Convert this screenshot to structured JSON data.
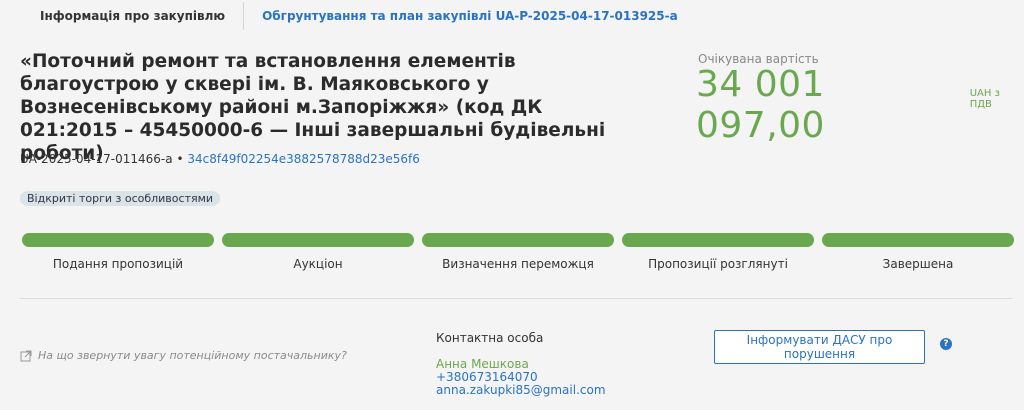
{
  "tabs": [
    {
      "label": "Інформація про закупівлю"
    },
    {
      "label": "Обгрунтування та план закупівлі UA-P-2025-04-17-013925-a"
    }
  ],
  "tender": {
    "title": "«Поточний ремонт та встановлення елементів благоустрою у сквері ім. В. Маяковського у Вознесенівському районі м.Запоріжжя» (код ДК 021:2015 – 45450000-6 — Інші завершальні будівельні роботи)",
    "id": "UA-2025-04-17-011466-a",
    "separator": "•",
    "hash": "34c8f49f02254e3882578788d23e56f6",
    "procedure_badge": "Відкриті торги з особливостями"
  },
  "price": {
    "label": "Очікувана вартість",
    "value": "34 001 097,00",
    "unit": "UAH з ПДВ"
  },
  "stages": [
    {
      "label": "Подання пропозицій",
      "completed": true
    },
    {
      "label": "Аукціон",
      "completed": true
    },
    {
      "label": "Визначення переможця",
      "completed": true
    },
    {
      "label": "Пропозиції розглянуті",
      "completed": true
    },
    {
      "label": "Завершена",
      "completed": true
    }
  ],
  "hint": {
    "text": "На що звернути увагу потенційному постачальнику?",
    "icon": "external-link-icon"
  },
  "contact": {
    "heading": "Контактна особа",
    "name": "Анна Мешкова",
    "phone": "+380673164070",
    "email": "anna.zakupki85@gmail.com"
  },
  "report_button": {
    "label": "Інформувати ДАСУ про порушення"
  },
  "help_icon": {
    "glyph": "?"
  },
  "colors": {
    "accent": "#2a73c4",
    "success": "#6aa84f",
    "badge_bg": "#d9e3e8"
  }
}
